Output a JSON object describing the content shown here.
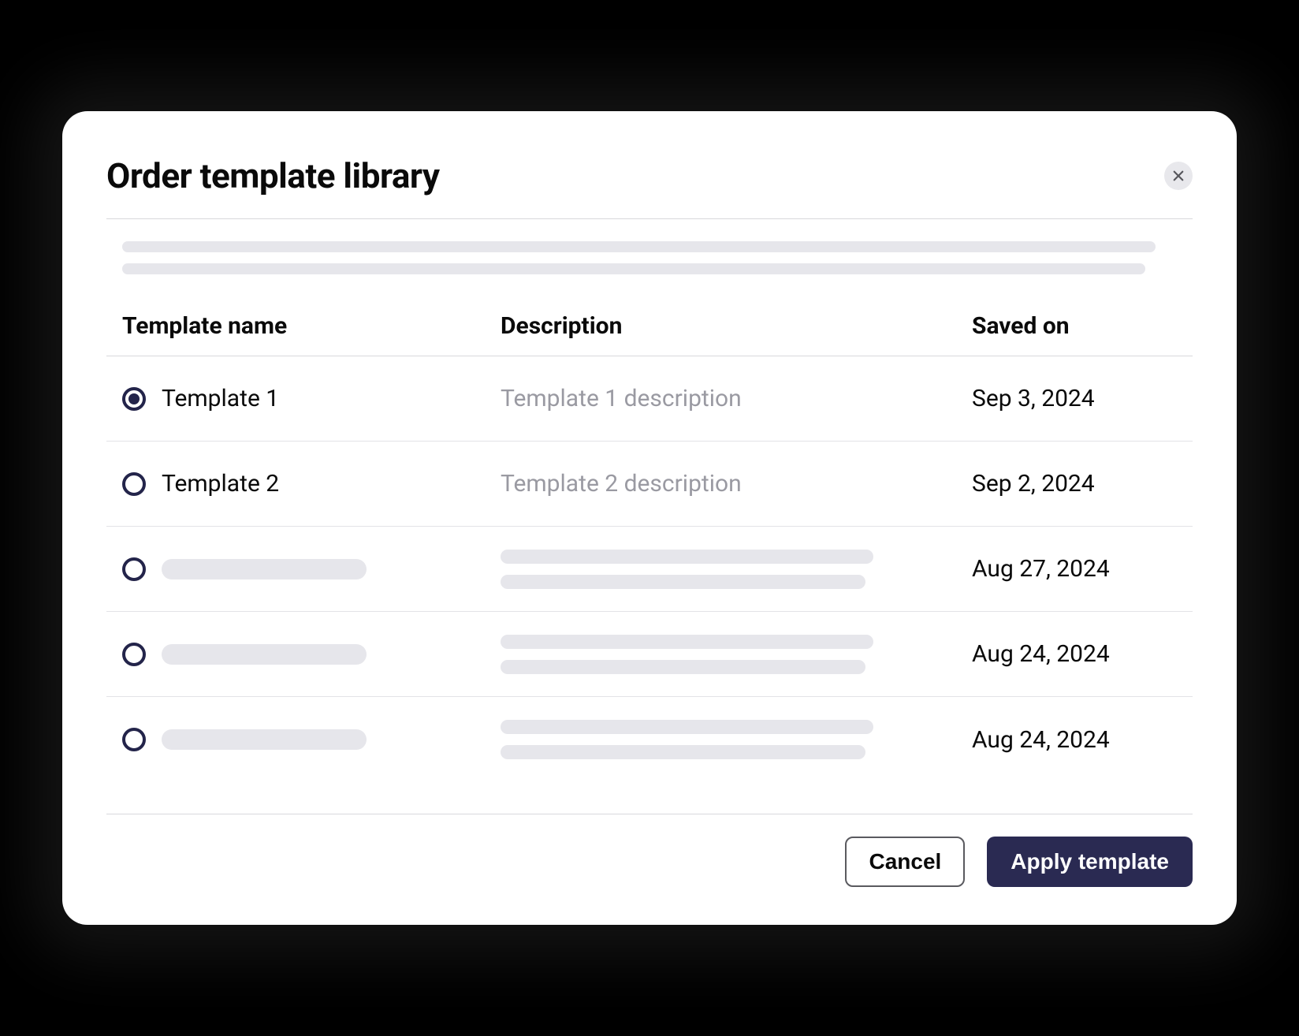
{
  "modal": {
    "title": "Order template library",
    "columns": {
      "name": "Template name",
      "description": "Description",
      "saved": "Saved on"
    },
    "rows": [
      {
        "selected": true,
        "loading": false,
        "name": "Template 1",
        "description": "Template 1 description",
        "saved": "Sep 3, 2024"
      },
      {
        "selected": false,
        "loading": false,
        "name": "Template 2",
        "description": "Template 2 description",
        "saved": "Sep 2, 2024"
      },
      {
        "selected": false,
        "loading": true,
        "name": "",
        "description": "",
        "saved": "Aug 27, 2024"
      },
      {
        "selected": false,
        "loading": true,
        "name": "",
        "description": "",
        "saved": "Aug 24, 2024"
      },
      {
        "selected": false,
        "loading": true,
        "name": "",
        "description": "",
        "saved": "Aug 24, 2024"
      }
    ],
    "actions": {
      "cancel": "Cancel",
      "apply": "Apply template"
    }
  }
}
